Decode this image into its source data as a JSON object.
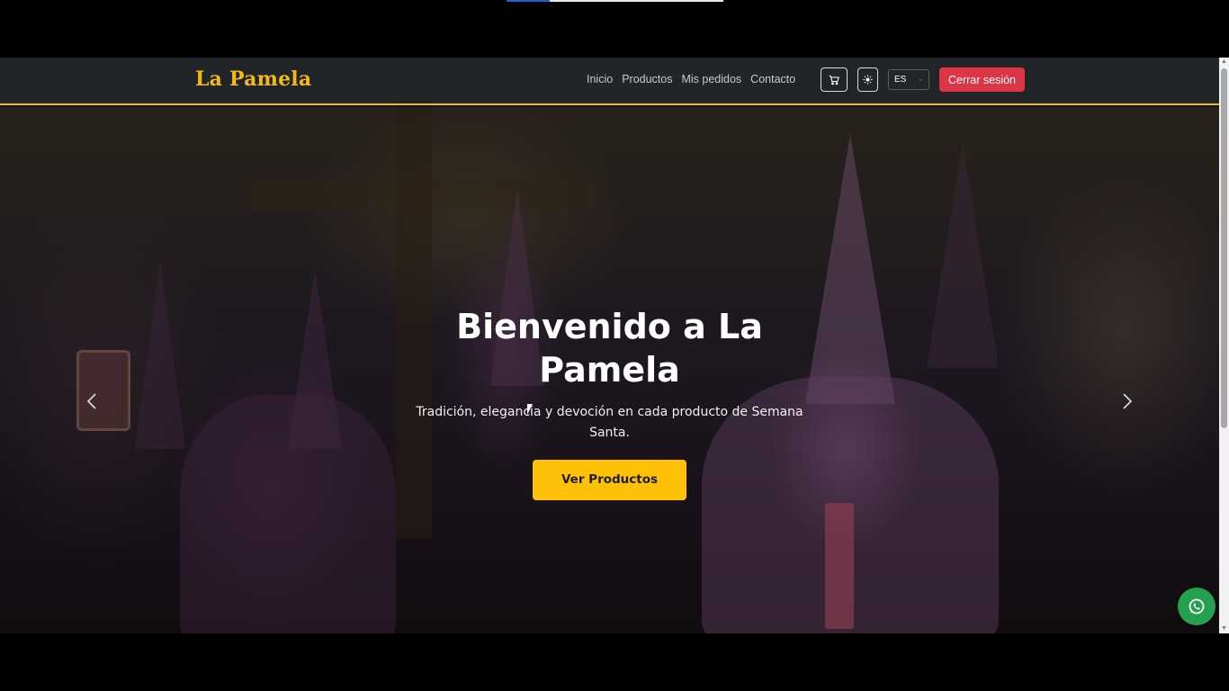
{
  "brand": {
    "name": "La Pamela",
    "color": "#f5b916"
  },
  "nav": {
    "links": [
      {
        "label": "Inicio"
      },
      {
        "label": "Productos"
      },
      {
        "label": "Mis pedidos"
      },
      {
        "label": "Contacto"
      }
    ],
    "cart_icon": "cart-icon",
    "theme_icon": "sun-icon",
    "language": "ES",
    "logout_label": "Cerrar sesión"
  },
  "hero": {
    "title": "Bienvenido a La Pamela",
    "subtitle": "Tradición, elegancia y devoción en cada producto de Semana Santa.",
    "cta_label": "Ver Productos",
    "prev_icon": "chevron-left-icon",
    "next_icon": "chevron-right-icon"
  },
  "floating": {
    "whatsapp_icon": "whatsapp-icon"
  },
  "colors": {
    "navbar_bg": "#212529",
    "accent": "#f5b916",
    "cta": "#ffc107",
    "danger": "#dc3545",
    "whatsapp": "#25a04f"
  }
}
